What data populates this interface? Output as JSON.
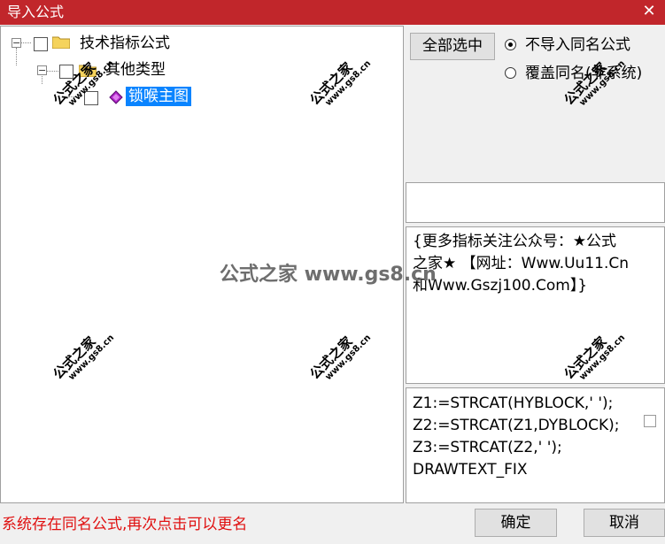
{
  "window": {
    "title": "导入公式",
    "close_symbol": "✕"
  },
  "tree": {
    "items": [
      {
        "label": "技术指标公式",
        "expander": "−"
      },
      {
        "label": "其他类型",
        "expander": "−"
      },
      {
        "label": "锁喉主图"
      }
    ]
  },
  "right": {
    "select_all_label": "全部选中",
    "radio_no_import_label": "不导入同名公式",
    "radio_overwrite_label": "覆盖同名(非系统)"
  },
  "description": {
    "line1": "{更多指标关注公众号：★公式",
    "line2": "之家★ 【网址：Www.Uu11.Cn",
    "line3": "和Www.Gszj100.Com】}"
  },
  "code": {
    "line1": "Z1:=STRCAT(HYBLOCK,' ');",
    "line2": "Z2:=STRCAT(Z1,DYBLOCK);",
    "line3": "Z3:=STRCAT(Z2,' ');",
    "line4": "DRAWTEXT_FIX"
  },
  "status": {
    "message": "系统存在同名公式,再次点击可以更名"
  },
  "buttons": {
    "ok_label": "确定",
    "cancel_label": "取消"
  },
  "watermark": {
    "cn": "公式之家",
    "url": "www.gs8.cn",
    "center": "公式之家 www.gs8.cn"
  },
  "colors": {
    "titlebar": "#c1262b",
    "selection": "#0a84ff",
    "error": "#e01010"
  }
}
